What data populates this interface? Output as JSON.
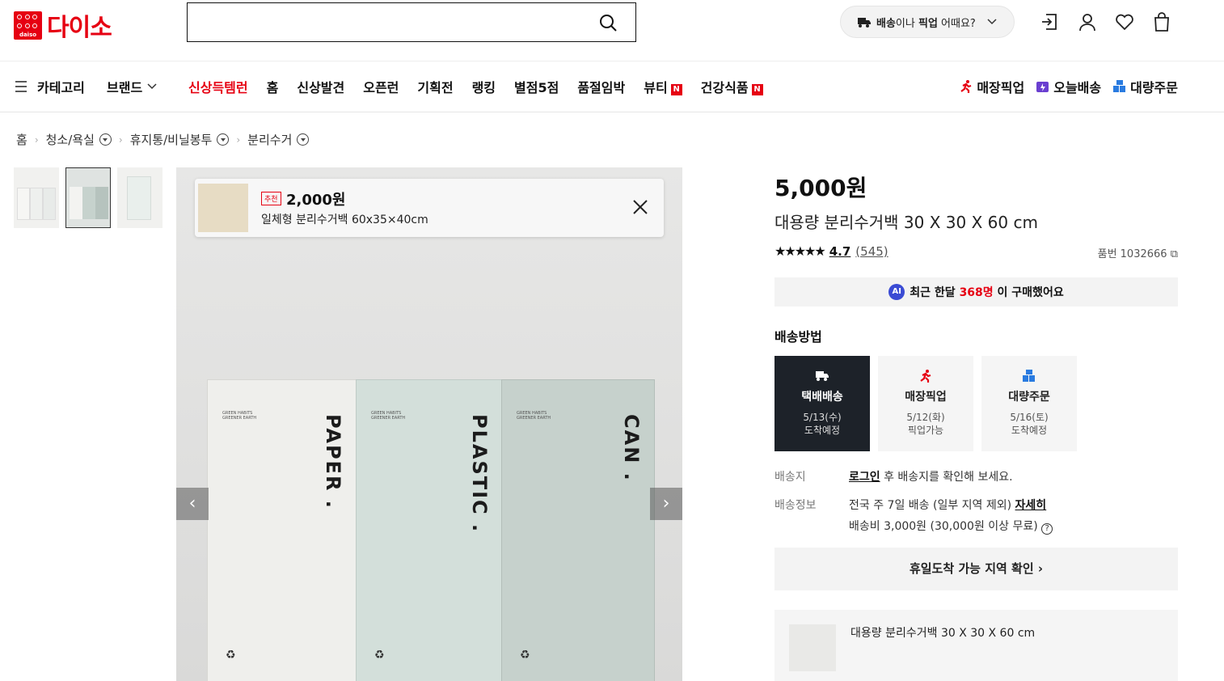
{
  "header": {
    "logo_small": "daiso",
    "logo_text": "다이소",
    "search_placeholder": "",
    "shipping_pill_bold": "배송",
    "shipping_pill_text": "이나 ",
    "shipping_pill_bold2": "픽업",
    "shipping_pill_text2": " 어때요?"
  },
  "nav": {
    "category": "카테고리",
    "brand": "브랜드",
    "menu": [
      "신상득템런",
      "홈",
      "신상발견",
      "오픈런",
      "기획전",
      "랭킹",
      "별점5점",
      "품절임박",
      "뷰티",
      "건강식품"
    ],
    "new_badge": "N",
    "services": [
      "매장픽업",
      "오늘배송",
      "대량주문"
    ]
  },
  "breadcrumb": [
    "홈",
    "청소/욕실",
    "휴지통/비닐봉투",
    "분리수거"
  ],
  "hero": {
    "bin_labels": [
      "PAPER .",
      "PLASTIC .",
      "CAN ."
    ],
    "tiny_text": "GREEN HABITS\nGREENER EARTH",
    "recycle_glyph": "♻",
    "prev": "‹",
    "next": "›",
    "rec_badge": "추천",
    "rec_price": "2,000원",
    "rec_name": "일체형 분리수거백 60x35×40cm"
  },
  "product": {
    "price": "5,000원",
    "title": "대용량 분리수거백 30 X 30 X 60 cm",
    "stars": "★★★★★",
    "rating": "4.7",
    "review_count": "(545)",
    "sku": "품번 1032666",
    "ai_badge": "AI",
    "ai_pre": "최근 한달 ",
    "ai_count": "368명",
    "ai_post": " 이 구매했어요",
    "ship_title": "배송방법",
    "options": [
      {
        "title": "택배배송",
        "date": "5/13(수)",
        "note": "도착예정"
      },
      {
        "title": "매장픽업",
        "date": "5/12(화)",
        "note": "픽업가능"
      },
      {
        "title": "대량주문",
        "date": "5/16(토)",
        "note": "도착예정"
      }
    ],
    "dest_key": "배송지",
    "dest_link": "로그인",
    "dest_text": " 후 배송지를 확인해 보세요.",
    "info_key": "배송정보",
    "info_text": "전국 주 7일 배송 (일부 지역 제외) ",
    "info_link": "자세히",
    "fee_text": "배송비 3,000원 (30,000원 이상 무료) ",
    "help_glyph": "?",
    "holiday": "휴일도착 가능 지역 확인",
    "selected_name": "대용량 분리수거백 30 X 30 X 60 cm"
  },
  "colors": {
    "brand_red": "#e60012",
    "selected_dark": "#1d2229",
    "ai_blue": "#3a4bd4"
  }
}
